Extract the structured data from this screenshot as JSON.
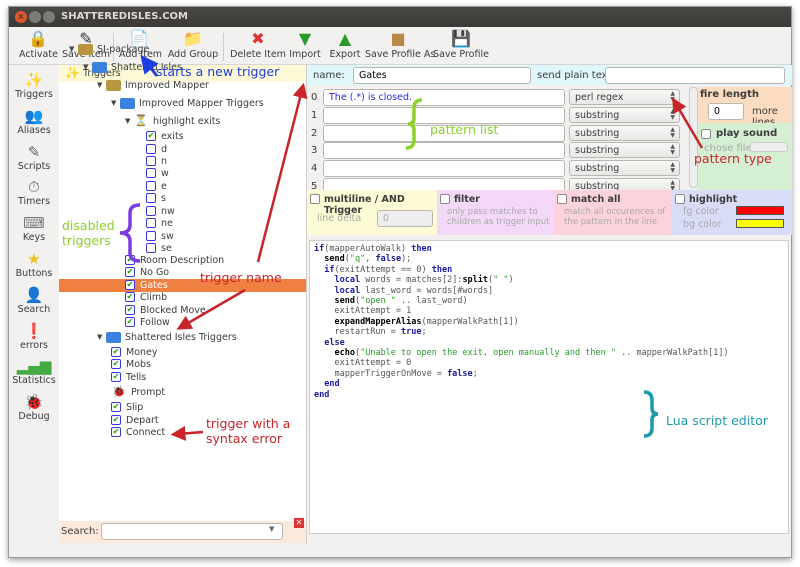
{
  "window": {
    "title": "SHATTEREDISLES.COM"
  },
  "toolbar": [
    {
      "label": "Activate",
      "icon": "lock-icon"
    },
    {
      "label": "Save Item",
      "icon": "save-item-icon"
    },
    {
      "label": "Add Item",
      "icon": "add-item-icon"
    },
    {
      "label": "Add Group",
      "icon": "add-group-icon"
    },
    {
      "label": "Delete Item",
      "icon": "delete-item-icon"
    },
    {
      "label": "Import",
      "icon": "import-icon"
    },
    {
      "label": "Export",
      "icon": "export-icon"
    },
    {
      "label": "Save Profile As",
      "icon": "box-icon"
    },
    {
      "label": "Save Profile",
      "icon": "floppy-icon"
    }
  ],
  "sidebar": [
    {
      "label": "Triggers",
      "icon": "wand-icon"
    },
    {
      "label": "Aliases",
      "icon": "people-icon"
    },
    {
      "label": "Scripts",
      "icon": "pencil-icon"
    },
    {
      "label": "Timers",
      "icon": "stopwatch-icon"
    },
    {
      "label": "Keys",
      "icon": "keyboard-icon"
    },
    {
      "label": "Buttons",
      "icon": "star-icon"
    },
    {
      "label": "Search",
      "icon": "person-icon"
    },
    {
      "label": "errors",
      "icon": "error-icon"
    },
    {
      "label": "Statistics",
      "icon": "bars-icon"
    },
    {
      "label": "Debug",
      "icon": "bug-icon"
    }
  ],
  "tree": {
    "root": "Triggers",
    "items": [
      {
        "label": "SI-package",
        "level": 0,
        "type": "folder",
        "color": "#b8963f"
      },
      {
        "label": "Shattered Isles",
        "level": 1,
        "type": "folder",
        "color": "#3b82e0"
      },
      {
        "label": "Improved Mapper",
        "level": 2,
        "type": "folder",
        "color": "#b8963f"
      },
      {
        "label": "Improved Mapper Triggers",
        "level": 3,
        "type": "folder",
        "color": "#3b82e0"
      },
      {
        "label": "highlight exits",
        "level": 4,
        "type": "filter"
      },
      {
        "label": "exits",
        "level": 5,
        "type": "item",
        "checked": true
      },
      {
        "label": "d",
        "level": 5,
        "type": "item",
        "checked": false
      },
      {
        "label": "n",
        "level": 5,
        "type": "item",
        "checked": false
      },
      {
        "label": "w",
        "level": 5,
        "type": "item",
        "checked": false
      },
      {
        "label": "e",
        "level": 5,
        "type": "item",
        "checked": false
      },
      {
        "label": "s",
        "level": 5,
        "type": "item",
        "checked": false
      },
      {
        "label": "nw",
        "level": 5,
        "type": "item",
        "checked": false
      },
      {
        "label": "ne",
        "level": 5,
        "type": "item",
        "checked": false
      },
      {
        "label": "sw",
        "level": 5,
        "type": "item",
        "checked": false
      },
      {
        "label": "se",
        "level": 5,
        "type": "item",
        "checked": false
      },
      {
        "label": "Room Description",
        "level": 4,
        "type": "item",
        "checked": true
      },
      {
        "label": "No Go",
        "level": 4,
        "type": "item",
        "checked": true
      },
      {
        "label": "Gates",
        "level": 4,
        "type": "item",
        "checked": true,
        "selected": true
      },
      {
        "label": "Climb",
        "level": 4,
        "type": "item",
        "checked": true
      },
      {
        "label": "Blocked Move",
        "level": 4,
        "type": "item",
        "checked": true
      },
      {
        "label": "Follow",
        "level": 4,
        "type": "item",
        "checked": true
      },
      {
        "label": "Shattered Isles Triggers",
        "level": 2,
        "type": "folder",
        "color": "#3b82e0"
      },
      {
        "label": "Money",
        "level": 3,
        "type": "item",
        "checked": true
      },
      {
        "label": "Mobs",
        "level": 3,
        "type": "item",
        "checked": true
      },
      {
        "label": "Tells",
        "level": 3,
        "type": "item",
        "checked": true
      },
      {
        "label": "Prompt",
        "level": 3,
        "type": "error"
      },
      {
        "label": "Slip",
        "level": 3,
        "type": "item",
        "checked": true
      },
      {
        "label": "Depart",
        "level": 3,
        "type": "item",
        "checked": true
      },
      {
        "label": "Connect",
        "level": 3,
        "type": "item",
        "checked": true
      }
    ],
    "search_label": "Search:",
    "search_value": ""
  },
  "editor": {
    "name_label": "name:",
    "name_value": "Gates",
    "send_label": "send plain text:",
    "send_value": "",
    "patterns": [
      {
        "n": "0",
        "text": "The (.*) is closed.",
        "type": "perl regex"
      },
      {
        "n": "1",
        "text": "",
        "type": "substring"
      },
      {
        "n": "2",
        "text": "",
        "type": "substring"
      },
      {
        "n": "3",
        "text": "",
        "type": "substring"
      },
      {
        "n": "4",
        "text": "",
        "type": "substring"
      },
      {
        "n": "5",
        "text": "",
        "type": "substring"
      }
    ],
    "fire_length": {
      "label": "fire length",
      "value": "0",
      "suffix": "more lines"
    },
    "play_sound": {
      "label": "play sound",
      "file_label": "chose file:"
    },
    "multiline": {
      "label": "multiline / AND Trigger",
      "delta_label": "line delta",
      "delta_value": "0"
    },
    "filter": {
      "label": "filter",
      "desc": "only pass matches to children as trigger input"
    },
    "match_all": {
      "label": "match all",
      "desc": "match all occurences of the pattern in the line"
    },
    "highlight": {
      "label": "highlight",
      "fg_label": "fg color",
      "bg_label": "bg color",
      "fg": "#ff0000",
      "bg": "#ffff00"
    },
    "script": [
      [
        [
          "kw",
          "if"
        ],
        [
          "",
          "(mapperAutoWalk) "
        ],
        [
          "kw",
          "then"
        ]
      ],
      [
        [
          "",
          "  "
        ],
        [
          "fn",
          "send"
        ],
        [
          "",
          "("
        ],
        [
          "str",
          "\"q\""
        ],
        [
          "",
          ", "
        ],
        [
          "kw",
          "false"
        ],
        [
          "",
          ");"
        ]
      ],
      [
        [
          "",
          "  "
        ],
        [
          "kw",
          "if"
        ],
        [
          "",
          "(exitAttempt == 0) "
        ],
        [
          "kw",
          "then"
        ]
      ],
      [
        [
          "",
          "    "
        ],
        [
          "kw",
          "local"
        ],
        [
          "",
          " words = matches[2]:"
        ],
        [
          "fn",
          "split"
        ],
        [
          "",
          "("
        ],
        [
          "str",
          "\" \""
        ],
        [
          "",
          ")"
        ]
      ],
      [
        [
          "",
          "    "
        ],
        [
          "kw",
          "local"
        ],
        [
          "",
          " last_word = words[#words]"
        ]
      ],
      [
        [
          "",
          "    "
        ],
        [
          "fn",
          "send"
        ],
        [
          "",
          "("
        ],
        [
          "str",
          "\"open \""
        ],
        [
          "",
          " .. last_word)"
        ]
      ],
      [
        [
          "",
          "    exitAttempt = 1"
        ]
      ],
      [
        [
          "",
          "    "
        ],
        [
          "fn",
          "expandMapperAlias"
        ],
        [
          "",
          "(mapperWalkPath[1])"
        ]
      ],
      [
        [
          "",
          "    restartRun = "
        ],
        [
          "kw",
          "true"
        ],
        [
          "",
          ";"
        ]
      ],
      [
        [
          "",
          "  "
        ],
        [
          "kw",
          "else"
        ]
      ],
      [
        [
          "",
          "    "
        ],
        [
          "fn",
          "echo"
        ],
        [
          "",
          "("
        ],
        [
          "str",
          "\"Unable to open the exit, open manually and then \""
        ],
        [
          "",
          " .. mapperWalkPath[1])"
        ]
      ],
      [
        [
          "",
          "    exitAttempt = 0"
        ]
      ],
      [
        [
          "",
          "    mapperTriggerOnMove = "
        ],
        [
          "kw",
          "false"
        ],
        [
          "",
          ";"
        ]
      ],
      [
        [
          "",
          "  "
        ],
        [
          "kw",
          "end"
        ]
      ],
      [
        [
          "kw",
          "end"
        ]
      ]
    ]
  },
  "annotations": {
    "new_trigger": "starts a new trigger",
    "pattern_list": "pattern list",
    "pattern_type": "pattern type",
    "disabled_1": "disabled",
    "disabled_2": "triggers",
    "trigger_name": "trigger name",
    "syntax_1": "trigger with a",
    "syntax_2": "syntax error",
    "lua": "Lua script editor",
    "colors": {
      "blue": "#1c3ee0",
      "green": "#8bd12a",
      "red": "#c8242a",
      "purple": "#7a3ce0",
      "teal": "#1b9aa8"
    }
  }
}
